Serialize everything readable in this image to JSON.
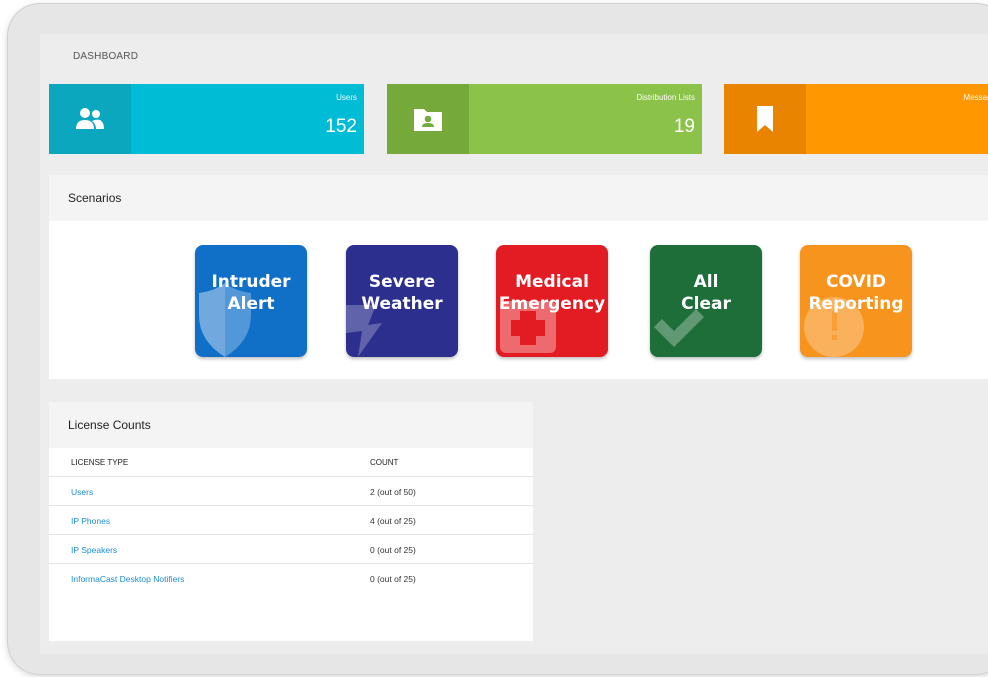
{
  "page": {
    "title": "DASHBOARD"
  },
  "stats": [
    {
      "label": "Users",
      "value": "152",
      "icon": "users-icon",
      "color": "#00bcd4",
      "dark": "#0aa7bf"
    },
    {
      "label": "Distribution Lists",
      "value": "19",
      "icon": "contact-folder-icon",
      "color": "#8bc34a",
      "dark": "#75a93a"
    },
    {
      "label": "Message",
      "value": "",
      "icon": "bookmark-icon",
      "color": "#ff9800",
      "dark": "#e88400"
    }
  ],
  "scenarios": {
    "heading": "Scenarios",
    "items": [
      {
        "line1": "Intruder",
        "line2": "Alert",
        "icon": "shield-icon",
        "color": "#1070c8"
      },
      {
        "line1": "Severe",
        "line2": "Weather",
        "icon": "lightning-icon",
        "color": "#2c2f8e"
      },
      {
        "line1": "Medical",
        "line2": "Emergency",
        "icon": "medical-cross-icon",
        "color": "#e31b23"
      },
      {
        "line1": "All",
        "line2": "Clear",
        "icon": "checkmark-icon",
        "color": "#1e6e3a"
      },
      {
        "line1": "COVID",
        "line2": "Reporting",
        "icon": "alert-circle-icon",
        "color": "#f7941d"
      }
    ]
  },
  "licenses": {
    "heading": "License Counts",
    "columns": [
      "LICENSE TYPE",
      "COUNT"
    ],
    "rows": [
      {
        "type": "Users",
        "count": "2 (out of 50)"
      },
      {
        "type": "IP Phones",
        "count": "4 (out of 25)"
      },
      {
        "type": "IP Speakers",
        "count": "0 (out of 25)"
      },
      {
        "type": "InformaCast Desktop Notifiers",
        "count": "0 (out of 25)"
      }
    ]
  }
}
